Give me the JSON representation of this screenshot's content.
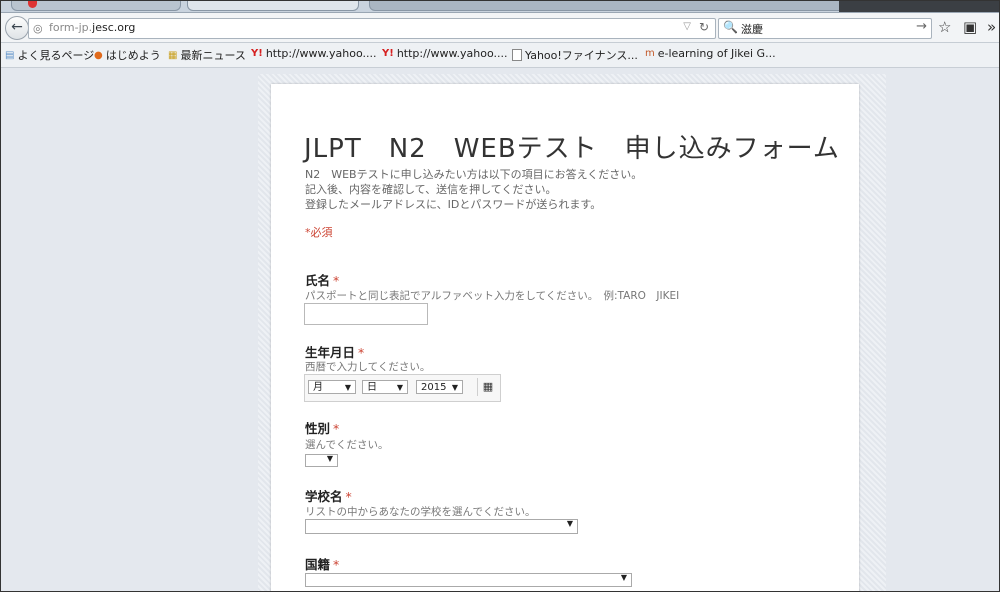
{
  "browser": {
    "url_prefix": "form-jp.",
    "url_domain": "jesc.org",
    "search_text": "滋慶",
    "back_glyph": "←",
    "globe_glyph": "◎",
    "reload_glyph": "↻",
    "dropdown_glyph": "▽",
    "search_glyph": "🔍",
    "go_glyph": "→",
    "star_glyph": "☆",
    "clipboard_glyph": "▣",
    "more_glyph": "»"
  },
  "bookmarks": [
    {
      "label": "よく見るページ",
      "icon": "folder-icon"
    },
    {
      "label": "はじめよう",
      "icon": "firefox-icon"
    },
    {
      "label": "最新ニュース",
      "icon": "news-icon"
    },
    {
      "label": "http://www.yahoo....",
      "icon": "yahoo-icon"
    },
    {
      "label": "http://www.yahoo....",
      "icon": "yahoo-icon"
    },
    {
      "label": "Yahoo!ファイナンス...",
      "icon": "page-icon"
    },
    {
      "label": "e-learning of Jikei G...",
      "icon": "m-icon"
    }
  ],
  "bookmark_glyphs": {
    "folder": "▤",
    "firefox": "●",
    "news": "▦",
    "yahoo": "Y!",
    "m": "m"
  },
  "form": {
    "title": "JLPT　N2　WEBテスト　申し込みフォーム",
    "description": [
      "N2　WEBテストに申し込みたい方は以下の項目にお答えください。",
      "記入後、内容を確認して、送信を押してください。",
      "登録したメールアドレスに、IDとパスワードが送られます。"
    ],
    "required_note": "*必須",
    "required_mark": "*",
    "fields": {
      "name": {
        "label": "氏名",
        "help": "パスポートと同じ表記でアルファベット入力をしてください。　例:TARO　JIKEI",
        "value": ""
      },
      "birthdate": {
        "label": "生年月日",
        "help": "西暦で入力してください。",
        "month": "月",
        "day": "日",
        "year": "2015",
        "calendar_glyph": "▦"
      },
      "gender": {
        "label": "性別",
        "help": "選んでください。",
        "value": ""
      },
      "school": {
        "label": "学校名",
        "help": "リストの中からあなたの学校を選んでください。",
        "value": ""
      },
      "nationality": {
        "label": "国籍",
        "value": ""
      }
    },
    "dropdown_arrow": "▼"
  }
}
